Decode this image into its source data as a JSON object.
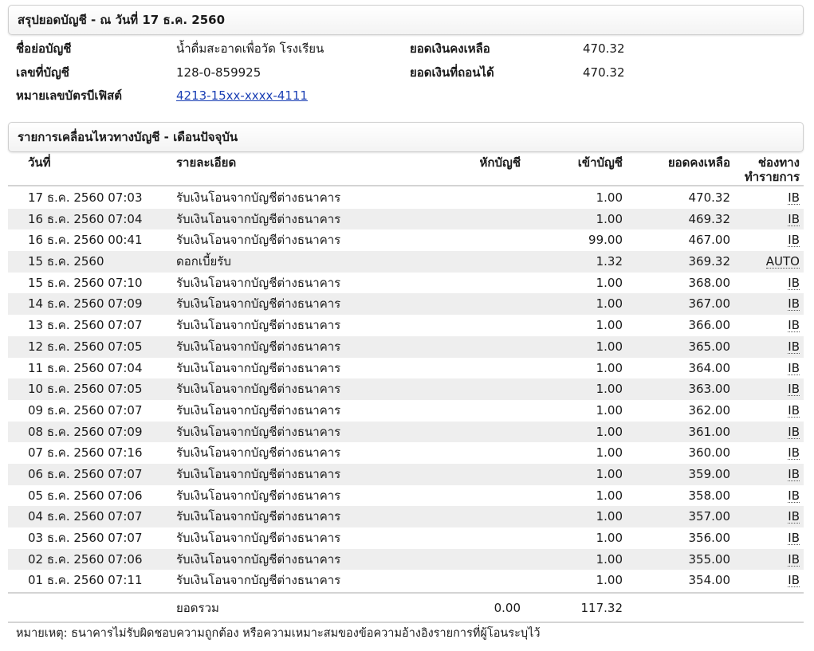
{
  "summary": {
    "title": "สรุปยอดบัญชี - ณ วันที่ 17 ธ.ค. 2560",
    "account_name_label": "ชื่อย่อบัญชี",
    "account_name_value": "น้ำดื่มสะอาดเพื่อวัด โรงเรียน",
    "account_number_label": "เลขที่บัญชี",
    "account_number_value": "128-0-859925",
    "debit_card_label": "หมายเลขบัตรบีเฟิสต์",
    "debit_card_value": "4213-15xx-xxxx-4111",
    "balance_label": "ยอดเงินคงเหลือ",
    "balance_value": "470.32",
    "withdrawable_label": "ยอดเงินที่ถอนได้",
    "withdrawable_value": "470.32"
  },
  "movement": {
    "title": "รายการเคลื่อนไหวทางบัญชี - เดือนปัจจุบัน",
    "headers": {
      "date": "วันที่",
      "description": "รายละเอียด",
      "debit": "หักบัญชี",
      "credit": "เข้าบัญชี",
      "balance": "ยอดคงเหลือ",
      "channel_line1": "ช่องทาง",
      "channel_line2": "ทำรายการ"
    },
    "rows": [
      {
        "date": "17 ธ.ค. 2560 07:03",
        "description": "รับเงินโอนจากบัญชีต่างธนาคาร",
        "debit": "",
        "credit": "1.00",
        "balance": "470.32",
        "channel": "IB"
      },
      {
        "date": "16 ธ.ค. 2560 07:04",
        "description": "รับเงินโอนจากบัญชีต่างธนาคาร",
        "debit": "",
        "credit": "1.00",
        "balance": "469.32",
        "channel": "IB"
      },
      {
        "date": "16 ธ.ค. 2560 00:41",
        "description": "รับเงินโอนจากบัญชีต่างธนาคาร",
        "debit": "",
        "credit": "99.00",
        "balance": "467.00",
        "channel": "IB"
      },
      {
        "date": "15 ธ.ค. 2560",
        "description": "ดอกเบี้ยรับ",
        "debit": "",
        "credit": "1.32",
        "balance": "369.32",
        "channel": "AUTO"
      },
      {
        "date": "15 ธ.ค. 2560 07:10",
        "description": "รับเงินโอนจากบัญชีต่างธนาคาร",
        "debit": "",
        "credit": "1.00",
        "balance": "368.00",
        "channel": "IB"
      },
      {
        "date": "14 ธ.ค. 2560 07:09",
        "description": "รับเงินโอนจากบัญชีต่างธนาคาร",
        "debit": "",
        "credit": "1.00",
        "balance": "367.00",
        "channel": "IB"
      },
      {
        "date": "13 ธ.ค. 2560 07:07",
        "description": "รับเงินโอนจากบัญชีต่างธนาคาร",
        "debit": "",
        "credit": "1.00",
        "balance": "366.00",
        "channel": "IB"
      },
      {
        "date": "12 ธ.ค. 2560 07:05",
        "description": "รับเงินโอนจากบัญชีต่างธนาคาร",
        "debit": "",
        "credit": "1.00",
        "balance": "365.00",
        "channel": "IB"
      },
      {
        "date": "11 ธ.ค. 2560 07:04",
        "description": "รับเงินโอนจากบัญชีต่างธนาคาร",
        "debit": "",
        "credit": "1.00",
        "balance": "364.00",
        "channel": "IB"
      },
      {
        "date": "10 ธ.ค. 2560 07:05",
        "description": "รับเงินโอนจากบัญชีต่างธนาคาร",
        "debit": "",
        "credit": "1.00",
        "balance": "363.00",
        "channel": "IB"
      },
      {
        "date": "09 ธ.ค. 2560 07:07",
        "description": "รับเงินโอนจากบัญชีต่างธนาคาร",
        "debit": "",
        "credit": "1.00",
        "balance": "362.00",
        "channel": "IB"
      },
      {
        "date": "08 ธ.ค. 2560 07:09",
        "description": "รับเงินโอนจากบัญชีต่างธนาคาร",
        "debit": "",
        "credit": "1.00",
        "balance": "361.00",
        "channel": "IB"
      },
      {
        "date": "07 ธ.ค. 2560 07:16",
        "description": "รับเงินโอนจากบัญชีต่างธนาคาร",
        "debit": "",
        "credit": "1.00",
        "balance": "360.00",
        "channel": "IB"
      },
      {
        "date": "06 ธ.ค. 2560 07:07",
        "description": "รับเงินโอนจากบัญชีต่างธนาคาร",
        "debit": "",
        "credit": "1.00",
        "balance": "359.00",
        "channel": "IB"
      },
      {
        "date": "05 ธ.ค. 2560 07:06",
        "description": "รับเงินโอนจากบัญชีต่างธนาคาร",
        "debit": "",
        "credit": "1.00",
        "balance": "358.00",
        "channel": "IB"
      },
      {
        "date": "04 ธ.ค. 2560 07:07",
        "description": "รับเงินโอนจากบัญชีต่างธนาคาร",
        "debit": "",
        "credit": "1.00",
        "balance": "357.00",
        "channel": "IB"
      },
      {
        "date": "03 ธ.ค. 2560 07:07",
        "description": "รับเงินโอนจากบัญชีต่างธนาคาร",
        "debit": "",
        "credit": "1.00",
        "balance": "356.00",
        "channel": "IB"
      },
      {
        "date": "02 ธ.ค. 2560 07:06",
        "description": "รับเงินโอนจากบัญชีต่างธนาคาร",
        "debit": "",
        "credit": "1.00",
        "balance": "355.00",
        "channel": "IB"
      },
      {
        "date": "01 ธ.ค. 2560 07:11",
        "description": "รับเงินโอนจากบัญชีต่างธนาคาร",
        "debit": "",
        "credit": "1.00",
        "balance": "354.00",
        "channel": "IB"
      }
    ],
    "total": {
      "label": "ยอดรวม",
      "debit": "0.00",
      "credit": "117.32"
    }
  },
  "note": "หมายเหตุ: ธนาคารไม่รับผิดชอบความถูกต้อง หรือความเหมาะสมของข้อความอ้างอิงรายการที่ผู้โอนระบุไว้",
  "colors": {
    "link": "#1a3fb4",
    "row_alt": "#eeeeee",
    "rule": "#d4d4d4"
  }
}
